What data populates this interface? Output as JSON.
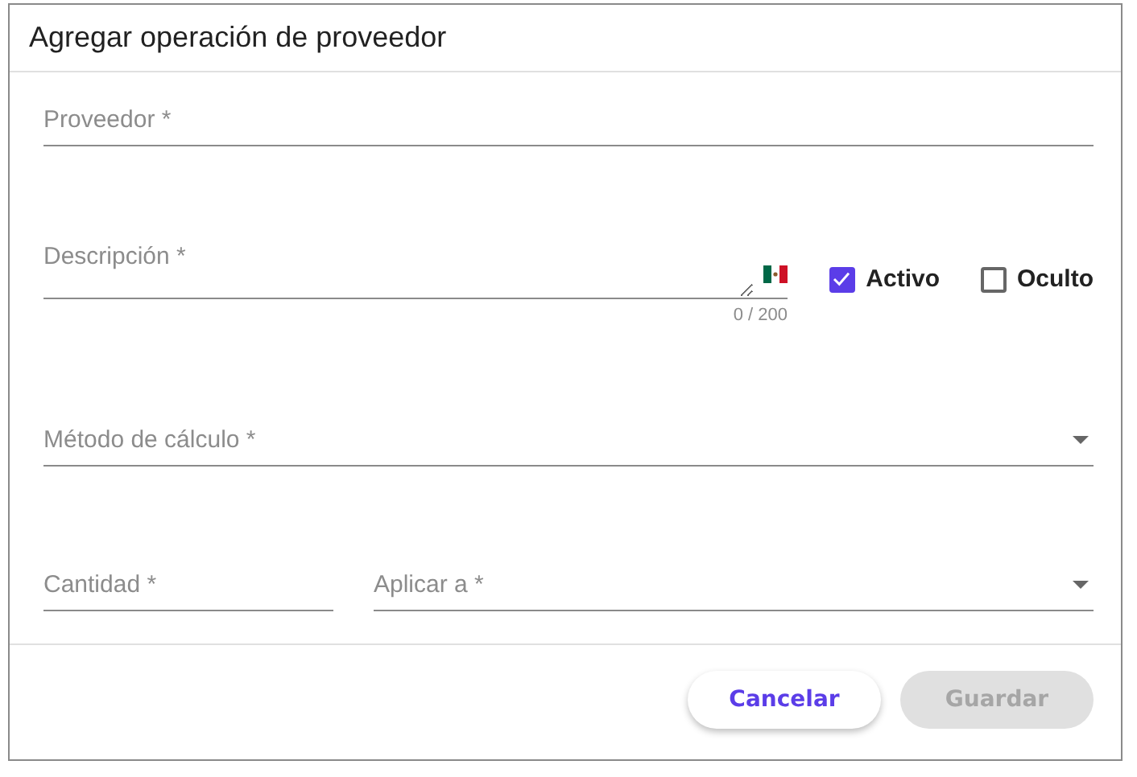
{
  "dialog": {
    "title": "Agregar operación de proveedor"
  },
  "fields": {
    "supplier": {
      "placeholder": "Proveedor *"
    },
    "description": {
      "placeholder": "Descripción *",
      "counter": "0 / 200"
    },
    "method": {
      "placeholder": "Método de cálculo *"
    },
    "quantity": {
      "placeholder": "Cantidad *"
    },
    "apply_to": {
      "placeholder": "Aplicar a *"
    }
  },
  "options": [
    {
      "label": "Activo",
      "checked": true
    },
    {
      "label": "Oculto",
      "checked": false
    }
  ],
  "buttons": [
    {
      "label": "Cancelar",
      "disabled": false
    },
    {
      "label": "Guardar",
      "disabled": true
    }
  ]
}
